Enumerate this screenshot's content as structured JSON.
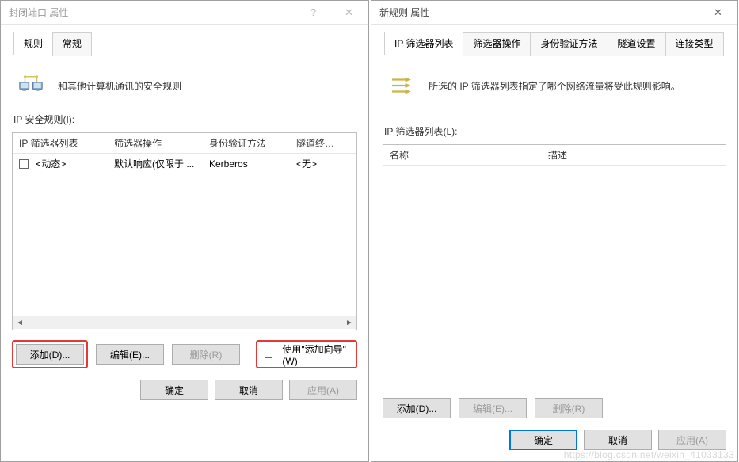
{
  "left_dialog": {
    "title": "封闭端口 属性",
    "help_icon": "?",
    "close_icon": "✕",
    "tabs": [
      "规则",
      "常规"
    ],
    "active_tab": 0,
    "info_text": "和其他计算机通讯的安全规则",
    "section_label": "IP 安全规则(I):",
    "columns": [
      "IP 筛选器列表",
      "筛选器操作",
      "身份验证方法",
      "隧道终结点"
    ],
    "rows": [
      {
        "filter": "<动态>",
        "action": "默认响应(仅限于 ...",
        "auth": "Kerberos",
        "tunnel": "<无>"
      }
    ],
    "buttons": {
      "add": "添加(D)...",
      "edit": "编辑(E)...",
      "delete": "删除(R)",
      "wizard": "使用\"添加向导\"(W)"
    },
    "footer": {
      "ok": "确定",
      "cancel": "取消",
      "apply": "应用(A)"
    }
  },
  "right_dialog": {
    "title": "新规则 属性",
    "close_icon": "✕",
    "tabs": [
      "IP 筛选器列表",
      "筛选器操作",
      "身份验证方法",
      "隧道设置",
      "连接类型"
    ],
    "active_tab": 0,
    "info_text": "所选的 IP 筛选器列表指定了哪个网络流量将受此规则影响。",
    "section_label": "IP 筛选器列表(L):",
    "columns": [
      "名称",
      "描述"
    ],
    "buttons": {
      "add": "添加(D)...",
      "edit": "编辑(E)...",
      "delete": "删除(R)"
    },
    "footer": {
      "ok": "确定",
      "cancel": "取消",
      "apply": "应用(A)"
    }
  },
  "watermark": "https://blog.csdn.net/weixin_41033133"
}
